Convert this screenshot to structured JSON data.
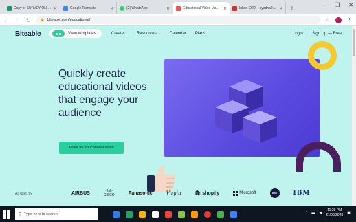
{
  "browser": {
    "tabs": [
      {
        "title": "Copy of SURVEY ON UTINO!",
        "color": "#0f9d58"
      },
      {
        "title": "Google Translate",
        "color": "#4285f4"
      },
      {
        "title": "(2) WhatsApp",
        "color": "#25d366"
      },
      {
        "title": "Educational Video Maker | Cre",
        "color": "#ff4d4d"
      },
      {
        "title": "Inbox (220) - syedna2014@g",
        "color": "#d93025"
      }
    ],
    "new_tab": "+",
    "window_controls": [
      "–",
      "❐",
      "✕"
    ],
    "url": "biteable.com/educational/"
  },
  "site": {
    "logo": "Biteable",
    "view_templates": "View templates",
    "nav": [
      {
        "label": "Create",
        "dropdown": true
      },
      {
        "label": "Resources",
        "dropdown": true
      },
      {
        "label": "Calendar",
        "dropdown": false
      },
      {
        "label": "Plans",
        "dropdown": false
      }
    ],
    "login": "Login",
    "signup": "Sign Up — Free",
    "headline": "Quickly create educational videos that engage your audience",
    "cta": "Make an educational video",
    "used_by": "As used by",
    "brands": {
      "airbus": "AIRBUS",
      "cisco_top": "·ılıılı·",
      "cisco": "CISCO",
      "panasonic": "Panasonic",
      "virgin": "Virgin",
      "shopify": "shopify",
      "microsoft": "Microsoft",
      "disc": "DISC",
      "ibm": "IBM"
    },
    "colors": {
      "accent": "#2bcf9d",
      "background": "#bff4ee",
      "hero": "#6a5ae8"
    }
  },
  "taskbar": {
    "search_placeholder": "Type here to search",
    "apps": [
      "#2d7be0",
      "#21a366",
      "#f4b400",
      "#ffffff",
      "#e8453c",
      "#8bc34a",
      "#ff9800",
      "#e53935",
      "#4caf50",
      "#3b82f6"
    ],
    "time": "11:29 PM",
    "date": "21/06/2020"
  }
}
